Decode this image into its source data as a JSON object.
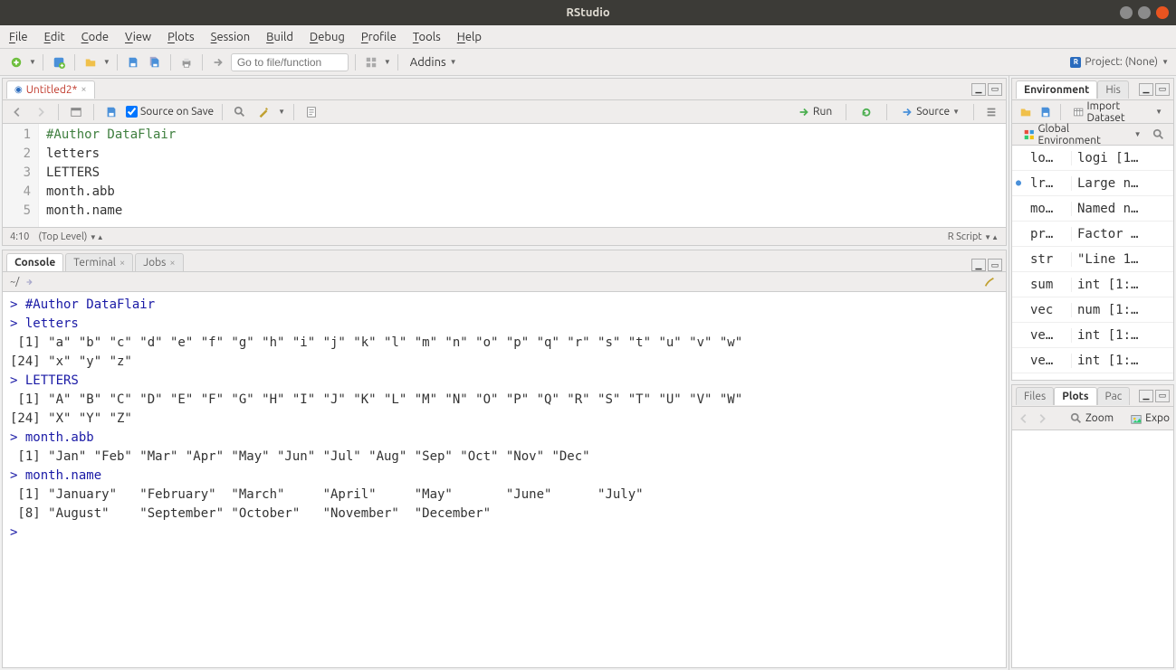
{
  "titlebar": {
    "title": "RStudio"
  },
  "menubar": {
    "items": [
      "File",
      "Edit",
      "Code",
      "View",
      "Plots",
      "Session",
      "Build",
      "Debug",
      "Profile",
      "Tools",
      "Help"
    ]
  },
  "toolbar": {
    "goto_placeholder": "Go to file/function",
    "addins_label": "Addins",
    "project_label": "Project: (None)"
  },
  "source": {
    "tab_title": "Untitled2*",
    "source_on_save": "Source on Save",
    "run_label": "Run",
    "source_label": "Source",
    "lines": [
      {
        "n": "1",
        "text": "#Author DataFlair",
        "cls": "comment"
      },
      {
        "n": "2",
        "text": "letters",
        "cls": ""
      },
      {
        "n": "3",
        "text": "LETTERS",
        "cls": ""
      },
      {
        "n": "4",
        "text": "month.abb",
        "cls": ""
      },
      {
        "n": "5",
        "text": "month.name",
        "cls": ""
      }
    ],
    "cursor": "4:10",
    "scope": "(Top Level)",
    "filetype": "R Script"
  },
  "console": {
    "tabs": [
      "Console",
      "Terminal",
      "Jobs"
    ],
    "path": "~/",
    "lines": [
      {
        "t": "cmd",
        "text": "> #Author DataFlair"
      },
      {
        "t": "cmd",
        "text": "> letters"
      },
      {
        "t": "out",
        "text": " [1] \"a\" \"b\" \"c\" \"d\" \"e\" \"f\" \"g\" \"h\" \"i\" \"j\" \"k\" \"l\" \"m\" \"n\" \"o\" \"p\" \"q\" \"r\" \"s\" \"t\" \"u\" \"v\" \"w\""
      },
      {
        "t": "out",
        "text": "[24] \"x\" \"y\" \"z\""
      },
      {
        "t": "cmd",
        "text": "> LETTERS"
      },
      {
        "t": "out",
        "text": " [1] \"A\" \"B\" \"C\" \"D\" \"E\" \"F\" \"G\" \"H\" \"I\" \"J\" \"K\" \"L\" \"M\" \"N\" \"O\" \"P\" \"Q\" \"R\" \"S\" \"T\" \"U\" \"V\" \"W\""
      },
      {
        "t": "out",
        "text": "[24] \"X\" \"Y\" \"Z\""
      },
      {
        "t": "cmd",
        "text": "> month.abb"
      },
      {
        "t": "out",
        "text": " [1] \"Jan\" \"Feb\" \"Mar\" \"Apr\" \"May\" \"Jun\" \"Jul\" \"Aug\" \"Sep\" \"Oct\" \"Nov\" \"Dec\""
      },
      {
        "t": "cmd",
        "text": "> month.name"
      },
      {
        "t": "out",
        "text": " [1] \"January\"   \"February\"  \"March\"     \"April\"     \"May\"       \"June\"      \"July\"     "
      },
      {
        "t": "out",
        "text": " [8] \"August\"    \"September\" \"October\"   \"November\"  \"December\" "
      },
      {
        "t": "cmd",
        "text": "> "
      }
    ]
  },
  "environment": {
    "tabs": [
      "Environment",
      "His"
    ],
    "import_label": "Import Dataset",
    "scope_label": "Global Environment",
    "rows": [
      {
        "exp": "",
        "name": "lo…",
        "val": "logi [1…"
      },
      {
        "exp": "●",
        "name": "lr…",
        "val": "Large n…"
      },
      {
        "exp": "",
        "name": "mo…",
        "val": "Named n…"
      },
      {
        "exp": "",
        "name": "pr…",
        "val": "Factor …"
      },
      {
        "exp": "",
        "name": "str",
        "val": "\"Line 1…"
      },
      {
        "exp": "",
        "name": "sum",
        "val": "int [1:…"
      },
      {
        "exp": "",
        "name": "vec",
        "val": "num [1:…"
      },
      {
        "exp": "",
        "name": "ve…",
        "val": "int [1:…"
      },
      {
        "exp": "",
        "name": "ve…",
        "val": "int [1:…"
      }
    ]
  },
  "plots": {
    "tabs": [
      "Files",
      "Plots",
      "Pac"
    ],
    "zoom_label": "Zoom",
    "export_label": "Expo"
  }
}
